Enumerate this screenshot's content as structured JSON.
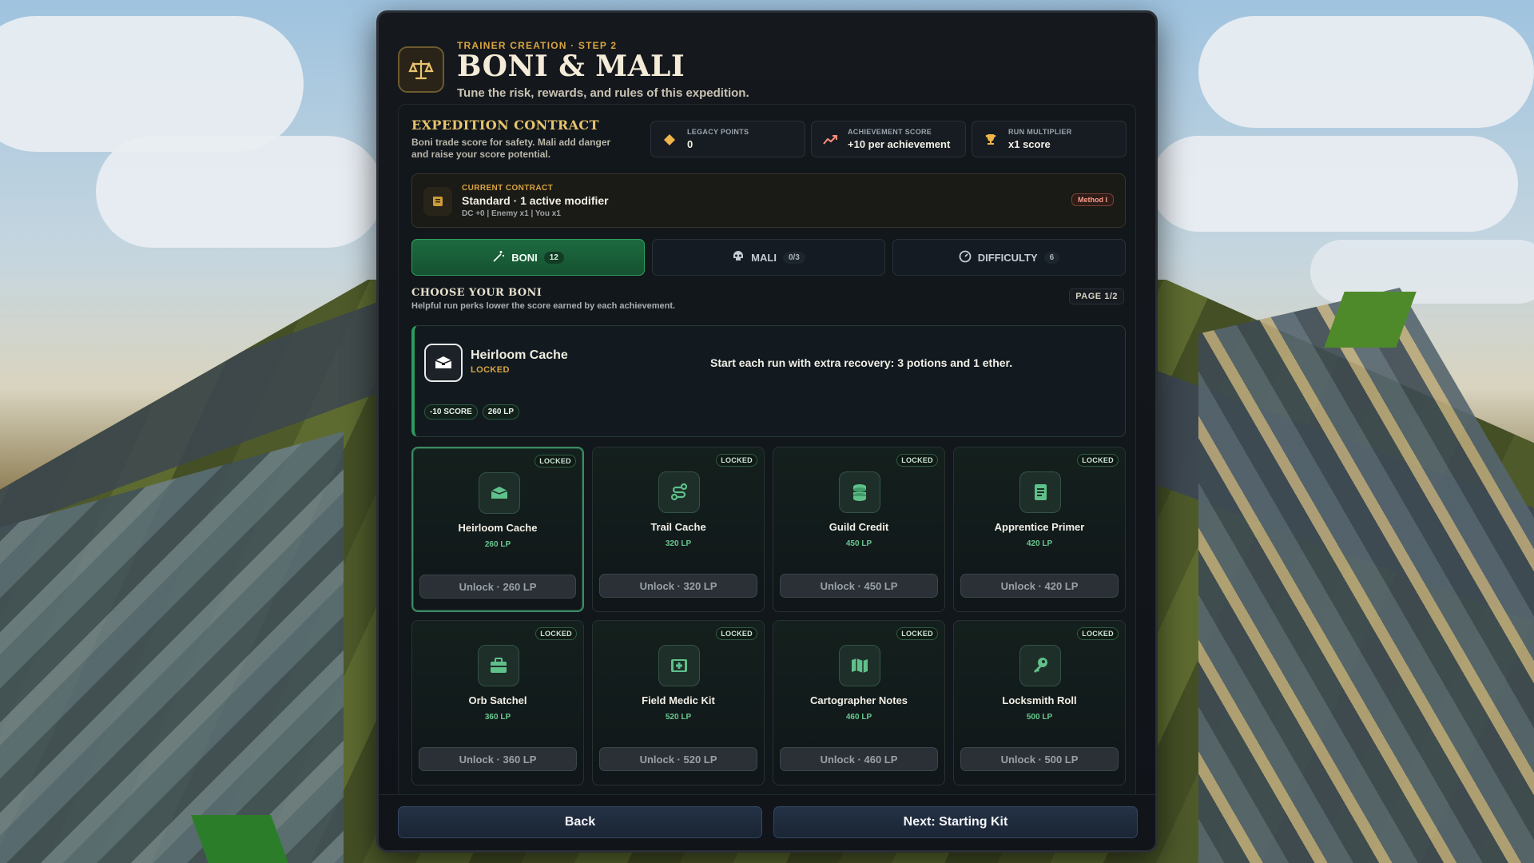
{
  "header": {
    "eyebrow": "TRAINER CREATION · STEP 2",
    "title": "BONI & MALI",
    "subtitle": "Tune the risk, rewards, and rules of this expedition.",
    "icon": "scale-icon"
  },
  "contract": {
    "title": "EXPEDITION CONTRACT",
    "description": "Boni trade score for safety. Mali add danger and raise your score potential."
  },
  "stats": [
    {
      "label": "LEGACY POINTS",
      "value": "0",
      "icon": "diamond-icon"
    },
    {
      "label": "ACHIEVEMENT SCORE",
      "value": "+10 per achievement",
      "icon": "trend-icon"
    },
    {
      "label": "RUN MULTIPLIER",
      "value": "x1 score",
      "icon": "trophy-icon"
    }
  ],
  "current_contract": {
    "label": "CURRENT CONTRACT",
    "value": "Standard · 1 active modifier",
    "meta": "DC +0 | Enemy x1 | You x1",
    "badge": "Method I"
  },
  "tabs": [
    {
      "label": "BONI",
      "count": "12",
      "active": true,
      "icon": "wand-icon"
    },
    {
      "label": "MALI",
      "count": "0/3",
      "active": false,
      "icon": "skull-icon"
    },
    {
      "label": "DIFFICULTY",
      "count": "6",
      "active": false,
      "icon": "gauge-icon"
    }
  ],
  "section": {
    "title": "CHOOSE YOUR BONI",
    "subtitle": "Helpful run perks lower the score earned by each achievement.",
    "page": "PAGE 1/2"
  },
  "feature": {
    "name": "Heirloom Cache",
    "status": "LOCKED",
    "description": "Start each run with extra recovery: 3 potions and 1 ether.",
    "chips": [
      "-10 SCORE",
      "260 LP"
    ]
  },
  "cards": [
    {
      "name": "Heirloom Cache",
      "cost": "260 LP",
      "lock": "LOCKED",
      "button": "Unlock · 260 LP",
      "icon": "chest-icon",
      "selected": true
    },
    {
      "name": "Trail Cache",
      "cost": "320 LP",
      "lock": "LOCKED",
      "button": "Unlock · 320 LP",
      "icon": "route-icon",
      "selected": false
    },
    {
      "name": "Guild Credit",
      "cost": "450 LP",
      "lock": "LOCKED",
      "button": "Unlock · 450 LP",
      "icon": "coins-icon",
      "selected": false
    },
    {
      "name": "Apprentice Primer",
      "cost": "420 LP",
      "lock": "LOCKED",
      "button": "Unlock · 420 LP",
      "icon": "book-icon",
      "selected": false
    },
    {
      "name": "Orb Satchel",
      "cost": "360 LP",
      "lock": "LOCKED",
      "button": "Unlock · 360 LP",
      "icon": "briefcase-icon",
      "selected": false
    },
    {
      "name": "Field Medic Kit",
      "cost": "520 LP",
      "lock": "LOCKED",
      "button": "Unlock · 520 LP",
      "icon": "medkit-icon",
      "selected": false
    },
    {
      "name": "Cartographer Notes",
      "cost": "460 LP",
      "lock": "LOCKED",
      "button": "Unlock · 460 LP",
      "icon": "map-icon",
      "selected": false
    },
    {
      "name": "Locksmith Roll",
      "cost": "500 LP",
      "lock": "LOCKED",
      "button": "Unlock · 500 LP",
      "icon": "key-icon",
      "selected": false
    }
  ],
  "footer": {
    "back_label": "Back",
    "next_label": "Next: Starting Kit"
  },
  "colors": {
    "accent_gold": "#d9a441",
    "accent_green": "#2f9a5c",
    "panel_bg": "#12171c"
  }
}
